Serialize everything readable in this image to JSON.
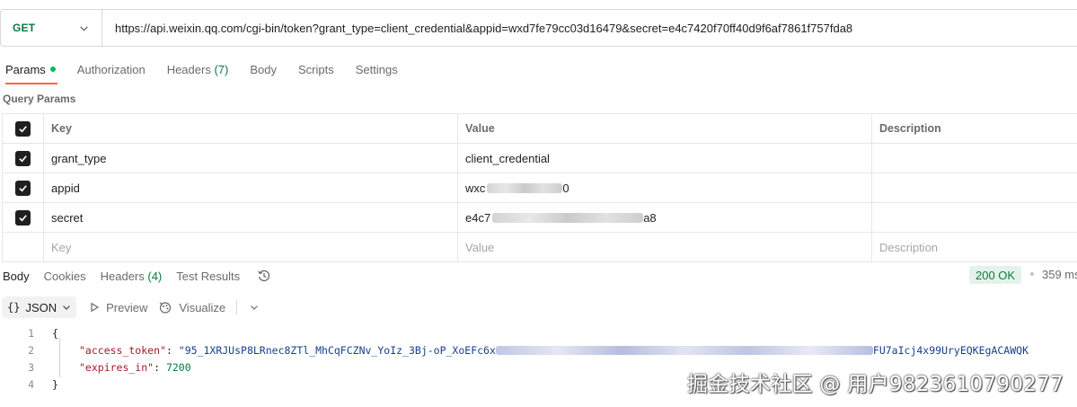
{
  "request": {
    "method": "GET",
    "url": "https://api.weixin.qq.com/cgi-bin/token?grant_type=client_credential&appid=wxd7fe79cc03d16479&secret=e4c7420f70ff40d9f6af7861f757fda8"
  },
  "request_tabs": {
    "params": "Params",
    "authorization": "Authorization",
    "headers": "Headers",
    "headers_count": "(7)",
    "body": "Body",
    "scripts": "Scripts",
    "settings": "Settings"
  },
  "query_params": {
    "title": "Query Params",
    "columns": {
      "key": "Key",
      "value": "Value",
      "description": "Description"
    },
    "rows": [
      {
        "key": "grant_type",
        "value": "client_credential"
      },
      {
        "key": "appid",
        "value_prefix": "wxc",
        "value_suffix": "0"
      },
      {
        "key": "secret",
        "value_prefix": "e4c7",
        "value_suffix": "a8"
      }
    ],
    "placeholder": {
      "key": "Key",
      "value": "Value",
      "description": "Description"
    }
  },
  "response_tabs": {
    "body": "Body",
    "cookies": "Cookies",
    "headers": "Headers",
    "headers_count": "(4)",
    "test_results": "Test Results"
  },
  "status": {
    "code": "200 OK",
    "time": "359 ms"
  },
  "toolbar": {
    "format": "JSON",
    "braces": "{}",
    "preview": "Preview",
    "visualize": "Visualize"
  },
  "code": {
    "line_numbers": [
      "1",
      "2",
      "3",
      "4"
    ],
    "open_brace": "{",
    "close_brace": "}",
    "access_token_key": "\"access_token\"",
    "access_token_prefix": "\"95_1XRJUsP8LRnec8ZTl_MhCqFCZNv_YoIz_3Bj-oP_XoEFc6x",
    "access_token_suffix": "FU7aIcj4x99UryEQKEgACAWQK",
    "expires_in_key": "\"expires_in\"",
    "expires_in_value": "7200",
    "colon": ": ",
    "comma": ","
  },
  "watermark": "掘金技术社区 @ 用户9823610790277",
  "colors": {
    "accent": "#ff6c37",
    "get_method": "#0a7a3f",
    "status_ok_bg": "#e4f3ea",
    "json_key": "#a8182c"
  }
}
